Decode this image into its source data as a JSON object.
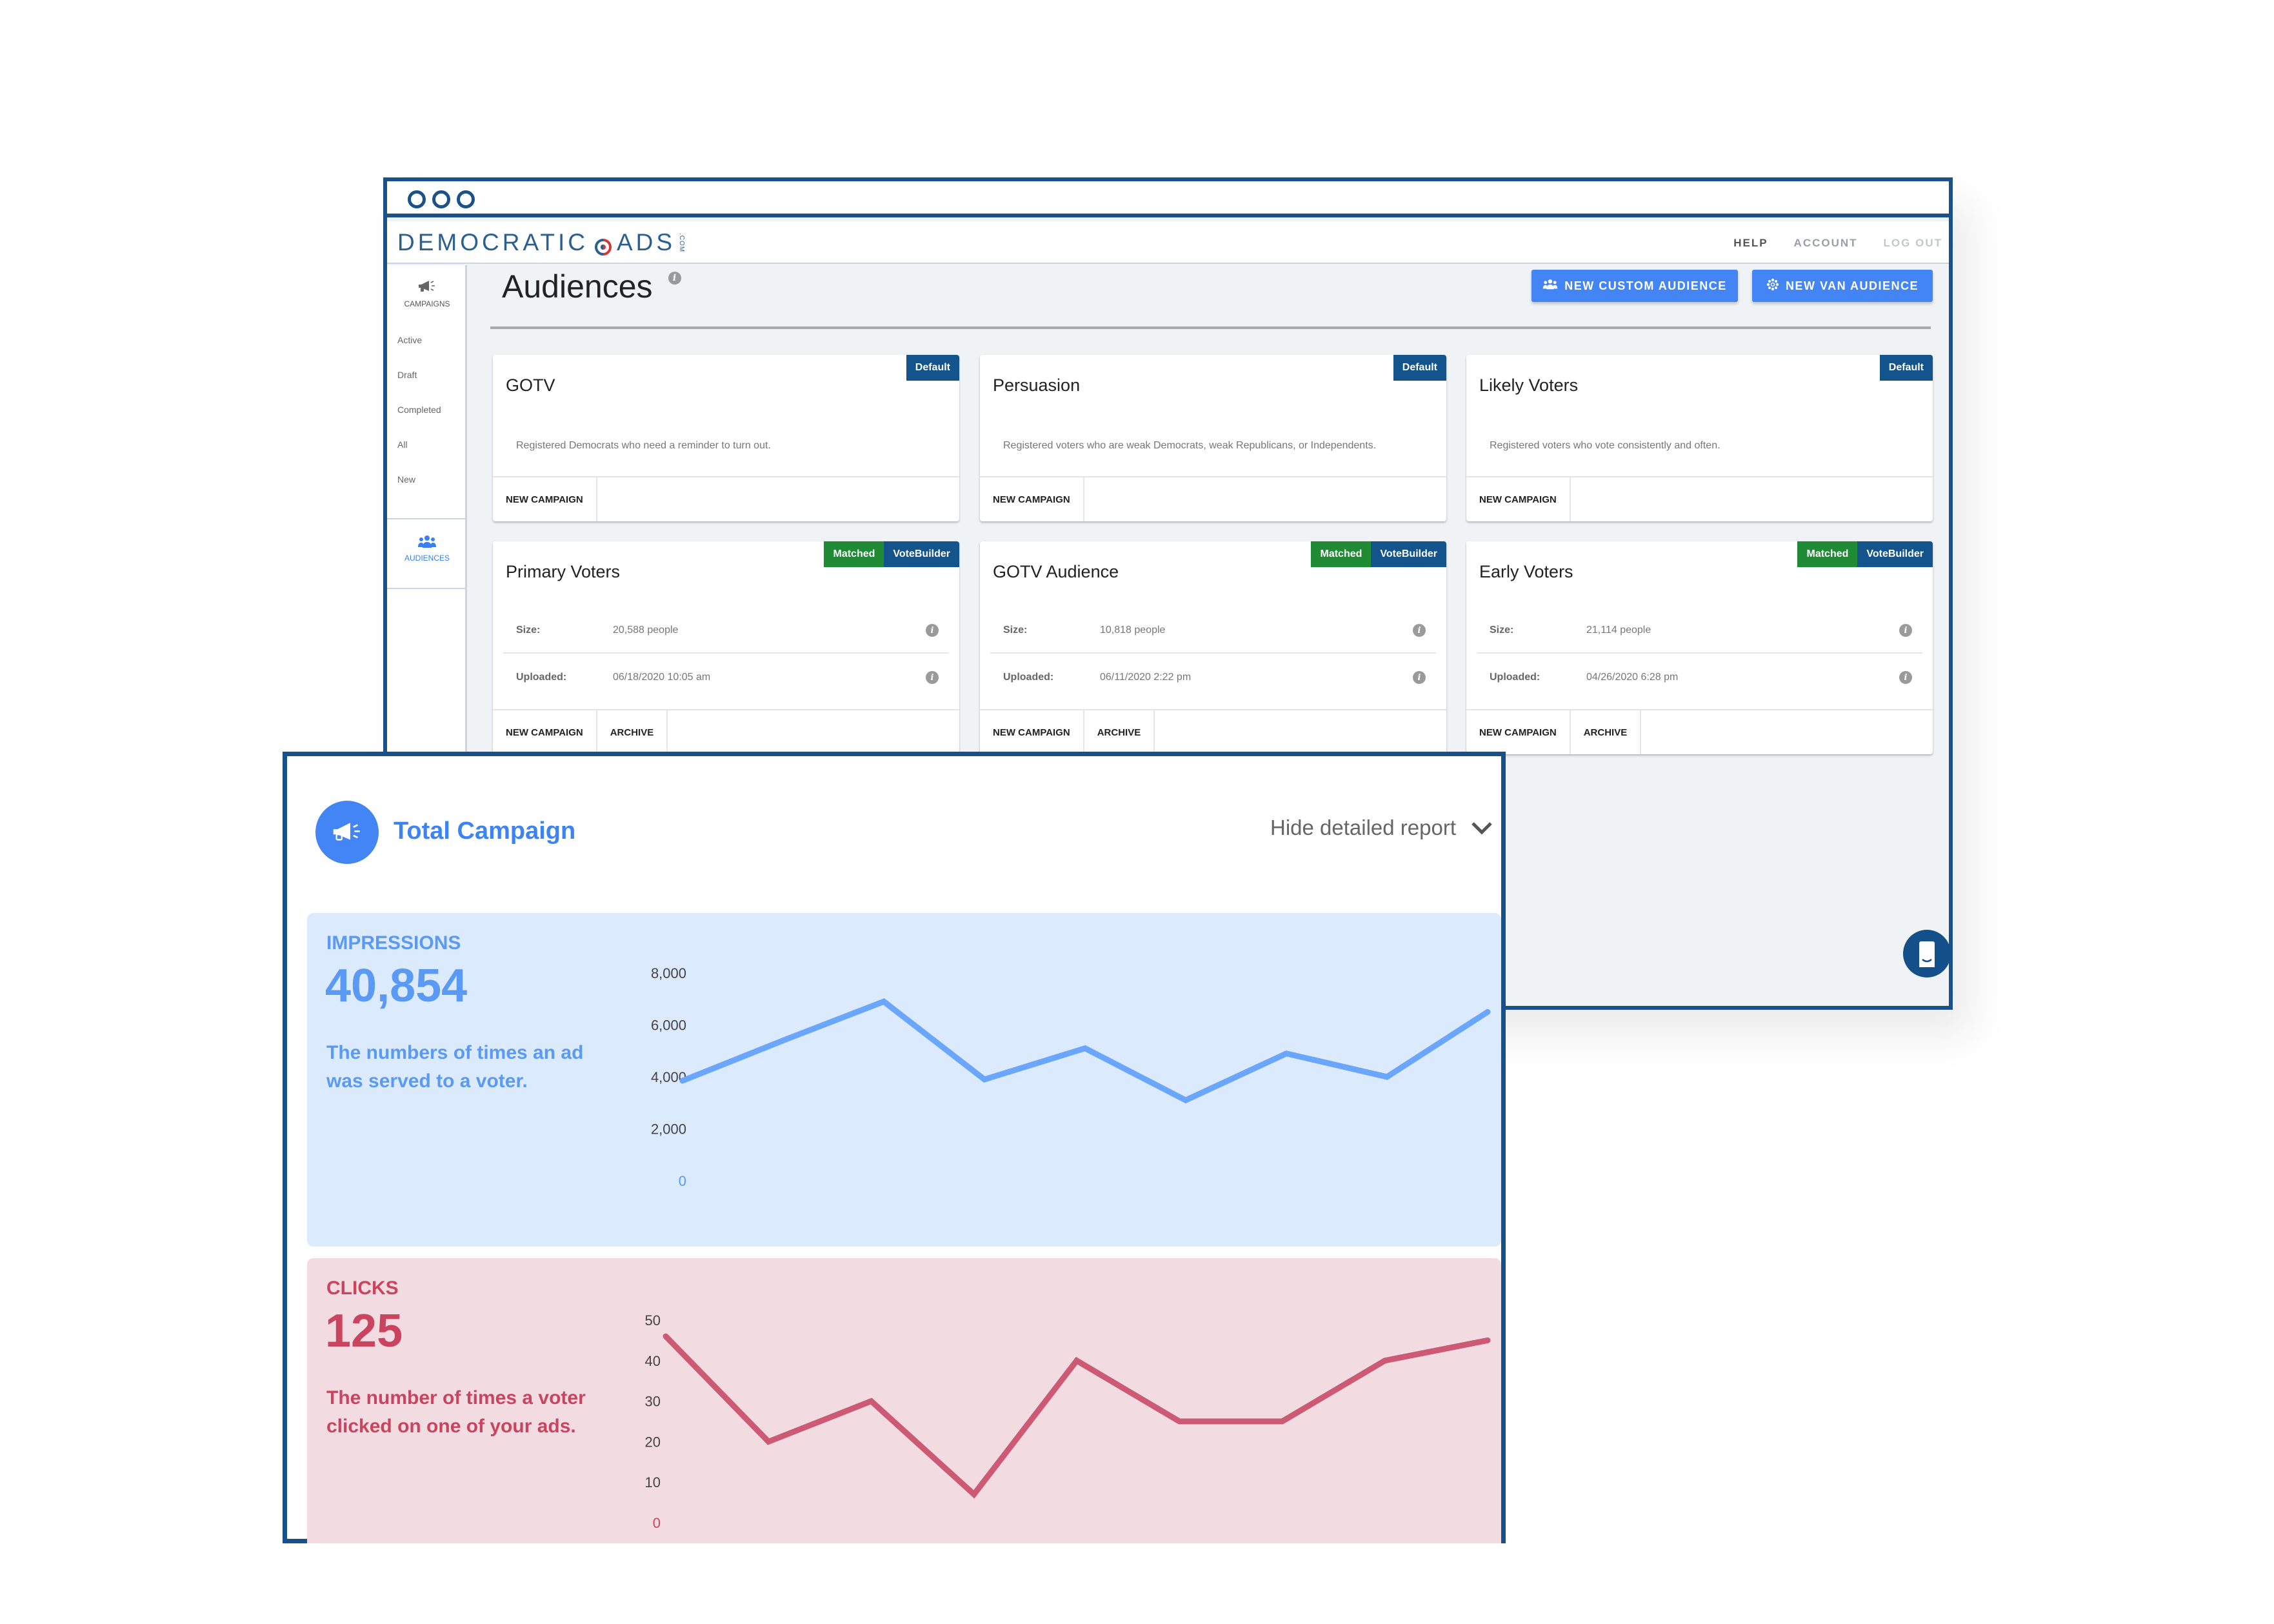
{
  "browser": {
    "window_dots": 3,
    "brand": {
      "name": "DEMOCRATIC",
      "name2": "ADS",
      "suffix": ".COM"
    },
    "top_nav": [
      {
        "label": "HELP",
        "state": "active"
      },
      {
        "label": "ACCOUNT",
        "state": "normal"
      },
      {
        "label": "LOG OUT",
        "state": "muted"
      }
    ],
    "sidebar": {
      "campaigns": {
        "icon": "megaphone-icon",
        "label": "CAMPAIGNS"
      },
      "items": [
        {
          "label": "Active"
        },
        {
          "label": "Draft"
        },
        {
          "label": "Completed"
        },
        {
          "label": "All"
        },
        {
          "label": "New"
        }
      ],
      "audiences": {
        "icon": "users-icon",
        "label": "AUDIENCES",
        "active": true
      }
    },
    "page": {
      "title": "Audiences",
      "info_icon": "info-icon",
      "buttons": [
        {
          "label": "NEW CUSTOM AUDIENCE",
          "icon": "users-icon"
        },
        {
          "label": "NEW VAN AUDIENCE",
          "icon": "gear-icon"
        }
      ]
    },
    "default_cards": [
      {
        "title": "GOTV",
        "badge": "Default",
        "description": "Registered Democrats who need a reminder to turn out.",
        "actions": [
          "NEW CAMPAIGN"
        ]
      },
      {
        "title": "Persuasion",
        "badge": "Default",
        "description": "Registered voters who are weak Democrats, weak Republicans, or Independents.",
        "actions": [
          "NEW CAMPAIGN"
        ]
      },
      {
        "title": "Likely Voters",
        "badge": "Default",
        "description": "Registered voters who vote consistently and often.",
        "actions": [
          "NEW CAMPAIGN"
        ]
      }
    ],
    "matched_cards": [
      {
        "title": "Primary Voters",
        "badges": [
          "Matched",
          "VoteBuilder"
        ],
        "size_label": "Size:",
        "size": "20,588 people",
        "uploaded_label": "Uploaded:",
        "uploaded": "06/18/2020 10:05 am",
        "actions": [
          "NEW CAMPAIGN",
          "ARCHIVE"
        ]
      },
      {
        "title": "GOTV Audience",
        "badges": [
          "Matched",
          "VoteBuilder"
        ],
        "size_label": "Size:",
        "size": "10,818 people",
        "uploaded_label": "Uploaded:",
        "uploaded": "06/11/2020 2:22 pm",
        "actions": [
          "NEW CAMPAIGN",
          "ARCHIVE"
        ]
      },
      {
        "title": "Early Voters",
        "badges": [
          "Matched",
          "VoteBuilder"
        ],
        "size_label": "Size:",
        "size": "21,114 people",
        "uploaded_label": "Uploaded:",
        "uploaded": "04/26/2020 6:28 pm",
        "actions": [
          "NEW CAMPAIGN",
          "ARCHIVE"
        ]
      }
    ],
    "chat_icon": "chat-bubble-icon"
  },
  "report": {
    "title": "Total Campaign",
    "icon": "megaphone-icon",
    "toggle_label": "Hide detailed report",
    "toggle_icon": "chevron-down-icon",
    "impressions": {
      "label": "IMPRESSIONS",
      "value": "40,854",
      "description": "The numbers of times an ad was served to a voter."
    },
    "clicks": {
      "label": "CLICKS",
      "value": "125",
      "description": "The number of times a voter clicked on one of your ads."
    }
  },
  "colors": {
    "frame": "#1b5088",
    "primary_button": "#4385f5",
    "badge_default": "#13548d",
    "badge_matched": "#1f8b34",
    "impressions_line": "#6aa6fb",
    "impressions_bg": "#dceafd",
    "clicks_line": "#cc5a74",
    "clicks_bg": "#f3dce1"
  },
  "chart_data": [
    {
      "type": "line",
      "title": "IMPRESSIONS",
      "xlabel": "",
      "ylabel": "",
      "x": [
        1,
        2,
        3,
        4,
        5,
        6,
        7,
        8,
        9
      ],
      "series": [
        {
          "name": "Impressions",
          "values": [
            3850,
            5400,
            6900,
            3900,
            5100,
            3100,
            4900,
            4000,
            6500
          ]
        }
      ],
      "yticks": [
        "0",
        "2,000",
        "4,000",
        "6,000",
        "8,000"
      ],
      "ytick_values": [
        0,
        2000,
        4000,
        6000,
        8000
      ],
      "ylim": [
        0,
        8000
      ],
      "grid": false,
      "legend": "none"
    },
    {
      "type": "line",
      "title": "CLICKS",
      "xlabel": "",
      "ylabel": "",
      "x": [
        1,
        2,
        3,
        4,
        5,
        6,
        7,
        8,
        9
      ],
      "series": [
        {
          "name": "Clicks",
          "values": [
            46,
            20,
            30,
            7,
            40,
            25,
            25,
            40,
            45
          ]
        }
      ],
      "yticks": [
        "0",
        "10",
        "20",
        "30",
        "40",
        "50"
      ],
      "ytick_values": [
        0,
        10,
        20,
        30,
        40,
        50
      ],
      "ylim": [
        0,
        50
      ],
      "grid": false,
      "legend": "none"
    }
  ]
}
